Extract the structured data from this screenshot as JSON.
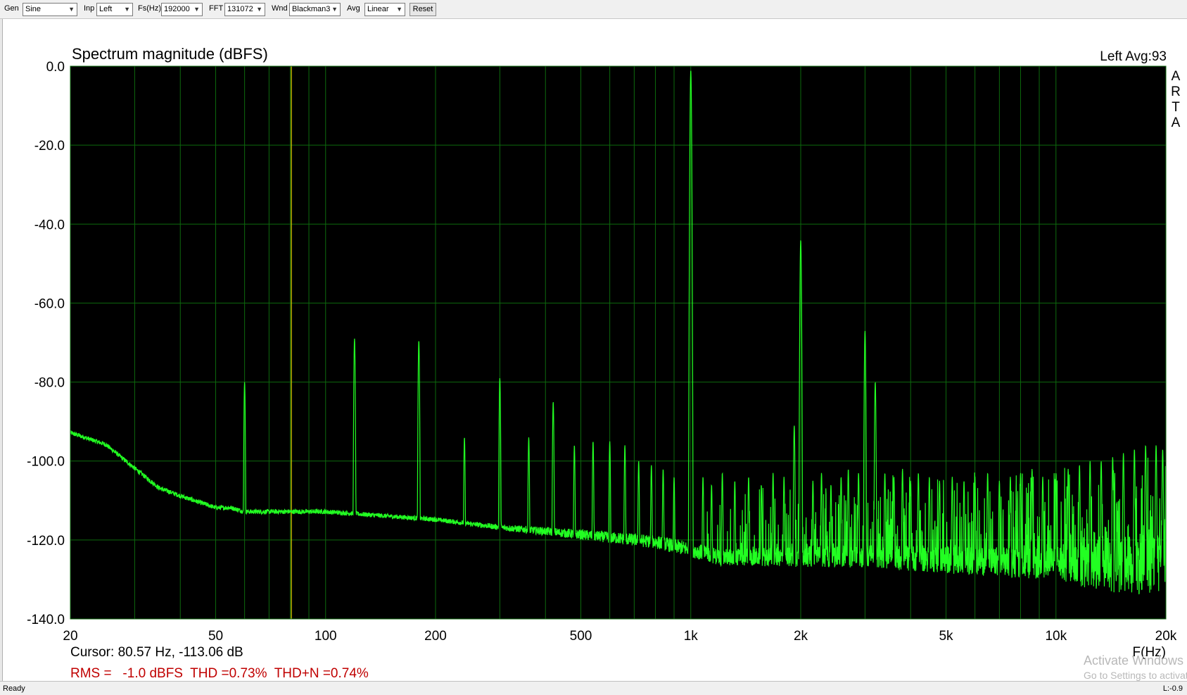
{
  "toolbar": {
    "gen_label": "Gen",
    "gen_value": "Sine",
    "inp_label": "Inp",
    "inp_value": "Left",
    "fs_label": "Fs(Hz)",
    "fs_value": "192000",
    "fft_label": "FFT",
    "fft_value": "131072",
    "wnd_label": "Wnd",
    "wnd_value": "Blackman3",
    "avg_label": "Avg",
    "avg_value": "Linear",
    "reset_label": "Reset"
  },
  "header": {
    "title": "Spectrum magnitude (dBFS)",
    "channel_avg": "Left  Avg:93",
    "side_letters": [
      "A",
      "R",
      "T",
      "A"
    ]
  },
  "readout": {
    "cursor": "Cursor: 80.57 Hz, -113.06 dB",
    "rms": "RMS =   -1.0 dBFS  THD =0.73%  THD+N =0.74%"
  },
  "status": {
    "left": "Ready",
    "right": "L:-0.9"
  },
  "watermark": {
    "line1": "Activate Windows",
    "line2": "Go to Settings to activate Windows."
  },
  "colors": {
    "plot_bg": "#000000",
    "grid": "#0d6a0d",
    "trace": "#22ff22",
    "cursor": "#d9cc00",
    "readout_red": "#c00000"
  },
  "chart_data": {
    "type": "line",
    "title": "Spectrum magnitude (dBFS)",
    "xlabel": "F(Hz)",
    "ylabel": "",
    "x_scale": "log",
    "xlim": [
      20,
      20000
    ],
    "ylim": [
      -140,
      0
    ],
    "x_tick_labels": [
      {
        "value": 20,
        "label": "20"
      },
      {
        "value": 50,
        "label": "50"
      },
      {
        "value": 100,
        "label": "100"
      },
      {
        "value": 200,
        "label": "200"
      },
      {
        "value": 500,
        "label": "500"
      },
      {
        "value": 1000,
        "label": "1k"
      },
      {
        "value": 2000,
        "label": "2k"
      },
      {
        "value": 5000,
        "label": "5k"
      },
      {
        "value": 10000,
        "label": "10k"
      },
      {
        "value": 20000,
        "label": "20k"
      }
    ],
    "x_minor_grid": [
      30,
      40,
      60,
      70,
      80,
      90,
      300,
      400,
      600,
      700,
      800,
      900,
      3000,
      4000,
      6000,
      7000,
      8000,
      9000
    ],
    "y_tick_labels": [
      {
        "value": 0,
        "label": "0.0"
      },
      {
        "value": -20,
        "label": "-20.0"
      },
      {
        "value": -40,
        "label": "-40.0"
      },
      {
        "value": -60,
        "label": "-60.0"
      },
      {
        "value": -80,
        "label": "-80.0"
      },
      {
        "value": -100,
        "label": "-100.0"
      },
      {
        "value": -120,
        "label": "-120.0"
      },
      {
        "value": -140,
        "label": "-140.0"
      }
    ],
    "grid": true,
    "cursor_x": 80.57,
    "series": [
      {
        "floor": [
          [
            20,
            -93
          ],
          [
            25,
            -96
          ],
          [
            30,
            -102
          ],
          [
            35,
            -107
          ],
          [
            40,
            -109
          ],
          [
            50,
            -112
          ],
          [
            55,
            -112
          ],
          [
            60,
            -113
          ],
          [
            70,
            -113
          ],
          [
            100,
            -113
          ],
          [
            200,
            -115
          ],
          [
            300,
            -117
          ],
          [
            500,
            -119
          ],
          [
            800,
            -121
          ],
          [
            1000,
            -123
          ],
          [
            1200,
            -125
          ],
          [
            2000,
            -125
          ],
          [
            3000,
            -125
          ],
          [
            5000,
            -126
          ],
          [
            8000,
            -127
          ],
          [
            10000,
            -127
          ],
          [
            14000,
            -129
          ],
          [
            20000,
            -127
          ]
        ],
        "peaks": [
          [
            60,
            -80
          ],
          [
            120,
            -69
          ],
          [
            180,
            -69.5
          ],
          [
            240,
            -94
          ],
          [
            300,
            -79
          ],
          [
            360,
            -94
          ],
          [
            420,
            -85
          ],
          [
            480,
            -96
          ],
          [
            1000,
            -1
          ],
          [
            2000,
            -44
          ],
          [
            3000,
            -67
          ],
          [
            3200,
            -80
          ],
          [
            540,
            -95
          ],
          [
            600,
            -95
          ],
          [
            660,
            -96
          ],
          [
            720,
            -100
          ],
          [
            780,
            -101
          ],
          [
            840,
            -102
          ],
          [
            900,
            -104
          ],
          [
            1080,
            -104
          ],
          [
            1140,
            -106
          ],
          [
            1220,
            -103
          ],
          [
            1320,
            -105
          ],
          [
            1440,
            -104
          ],
          [
            1560,
            -106
          ],
          [
            1680,
            -103
          ],
          [
            1800,
            -104
          ],
          [
            1920,
            -91
          ],
          [
            2160,
            -105
          ],
          [
            2280,
            -103
          ],
          [
            2420,
            -106
          ],
          [
            2580,
            -104
          ],
          [
            2700,
            -102
          ],
          [
            2880,
            -103
          ],
          [
            3400,
            -103
          ],
          [
            3600,
            -104
          ],
          [
            3800,
            -102
          ],
          [
            4000,
            -105
          ],
          [
            4200,
            -103
          ],
          [
            4500,
            -104
          ],
          [
            4800,
            -105
          ],
          [
            5200,
            -104
          ],
          [
            5600,
            -105
          ],
          [
            6000,
            -104
          ],
          [
            6500,
            -103
          ],
          [
            7000,
            -105
          ],
          [
            7500,
            -104
          ],
          [
            8000,
            -103
          ],
          [
            8600,
            -102
          ],
          [
            9200,
            -104
          ],
          [
            10000,
            -103
          ],
          [
            10800,
            -102
          ],
          [
            11600,
            -101
          ],
          [
            12400,
            -100
          ],
          [
            13300,
            -100
          ],
          [
            14300,
            -99
          ],
          [
            15300,
            -98
          ],
          [
            16400,
            -97
          ],
          [
            17600,
            -96
          ],
          [
            18800,
            -96
          ],
          [
            19600,
            -97
          ]
        ]
      }
    ]
  }
}
